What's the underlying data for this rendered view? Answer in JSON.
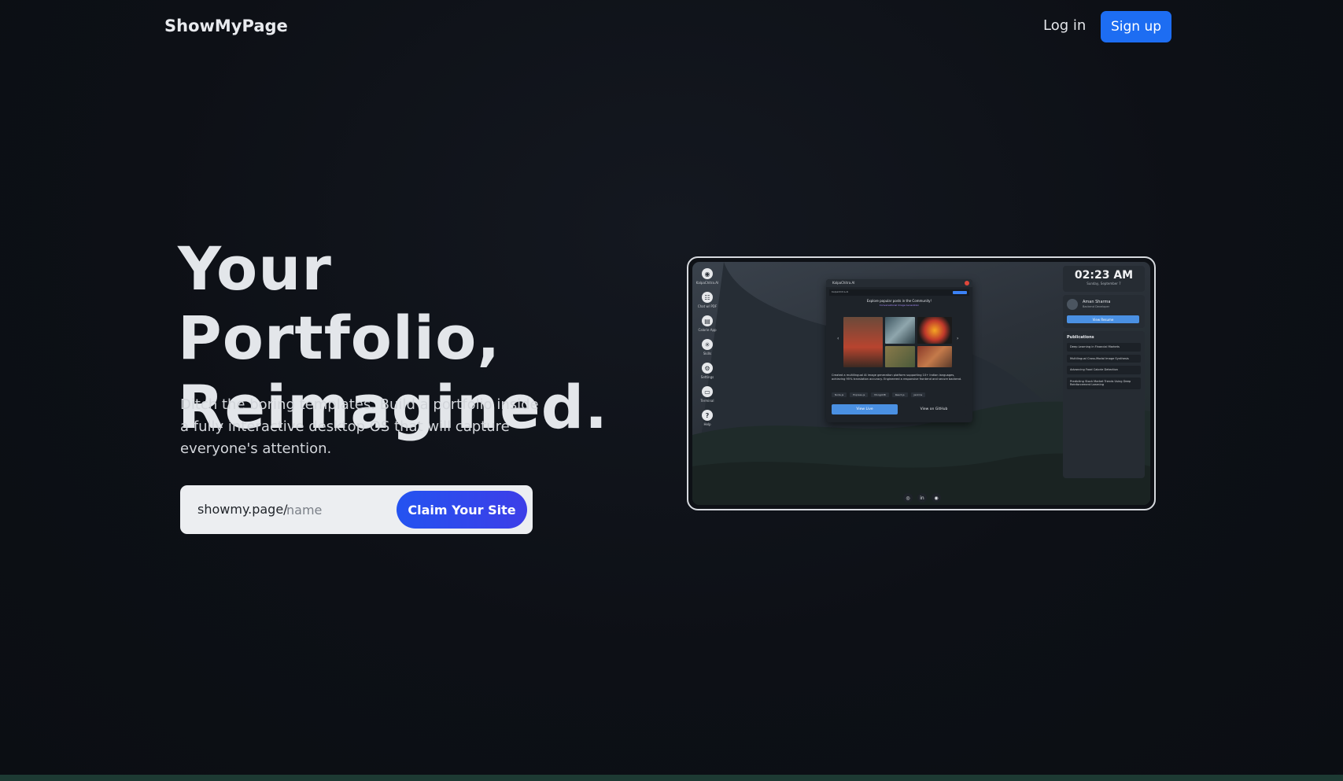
{
  "nav": {
    "logo": "ShowMyPage",
    "login_label": "Log in",
    "signup_label": "Sign up"
  },
  "hero": {
    "headline_line1": "Your Portfolio,",
    "headline_line2": "Reimagined.",
    "subtext": "Ditch the boring templates. Build a portfolio inside a fully interactive desktop OS that will capture everyone's attention.",
    "url_prefix": "showmy.page/",
    "url_placeholder": "name",
    "claim_label": "Claim Your Site"
  },
  "preview": {
    "dock": [
      {
        "icon": "app-logo-icon",
        "glyph": "◉",
        "label": "KalpaChitra.AI"
      },
      {
        "icon": "chat-icon",
        "glyph": "☷",
        "label": "Chat w/ PDF"
      },
      {
        "icon": "calorie-icon",
        "glyph": "▤",
        "label": "Calorie App"
      },
      {
        "icon": "skills-icon",
        "glyph": "✳",
        "label": "Skills"
      },
      {
        "icon": "settings-icon",
        "glyph": "⚙",
        "label": "Settings"
      },
      {
        "icon": "terminal-icon",
        "glyph": "▭",
        "label": "Terminal"
      },
      {
        "icon": "help-icon",
        "glyph": "?",
        "label": "Help"
      }
    ],
    "window": {
      "title": "KalpaChitra.AI",
      "nav_label": "KalpaChitra.AI",
      "heading": "Explore popular posts in the Community!",
      "subheading": "Conversational Image Generation",
      "description": "Created a multilingual AI image generation platform supporting 10+ Indian languages, achieving 95% translation accuracy. Engineered a responsive frontend and secure backend.",
      "tags": [
        "Node.js",
        "Express.js",
        "MongoDB",
        "React.js",
        "Jenkins"
      ],
      "live_label": "View Live",
      "github_label": "View on GitHub"
    },
    "clock": {
      "time": "02:23 AM",
      "date": "Sunday, September 7"
    },
    "profile": {
      "name": "Aman Sharma",
      "role": "Backend Developer",
      "resume_label": "View Resume"
    },
    "publications_heading": "Publications",
    "publications": [
      "Deep Learning in Financial Markets",
      "Multilingual Cross-Modal Image Synthesis",
      "Advancing Food Calorie Detection",
      "Predicting Stock Market Trends Using Deep Reinforcement Learning"
    ],
    "bottom_dock": [
      {
        "icon": "github-icon",
        "glyph": "◎"
      },
      {
        "icon": "linkedin-icon",
        "glyph": "in"
      },
      {
        "icon": "app-logo-icon",
        "glyph": "◉"
      }
    ]
  },
  "colors": {
    "background": "#0c0f14",
    "accent": "#1d6df2",
    "cta": "#2453f0"
  }
}
